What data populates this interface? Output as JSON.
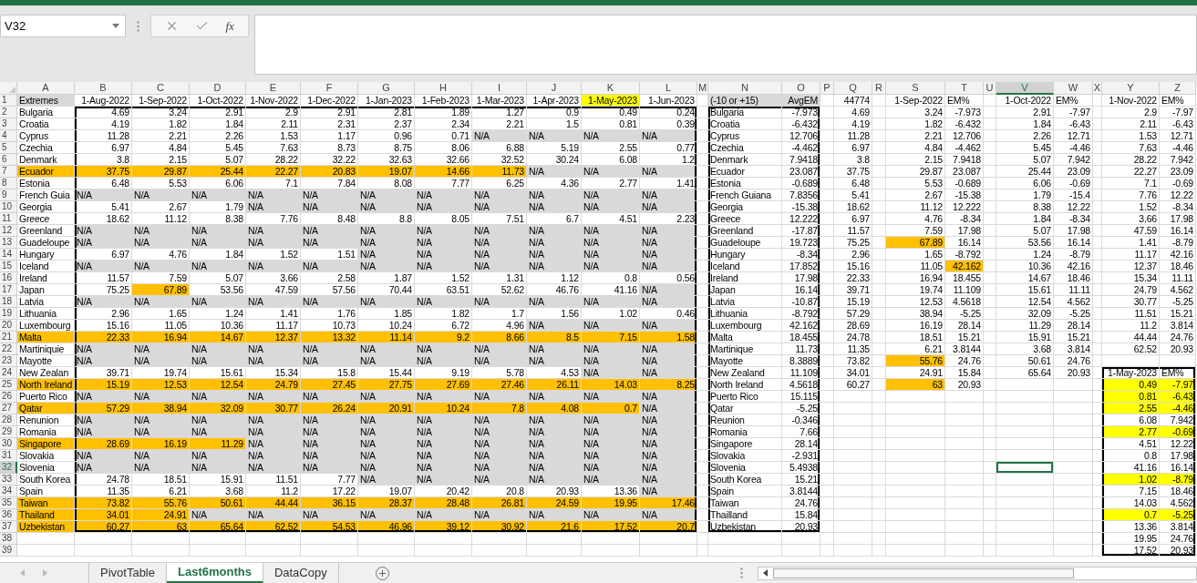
{
  "name_box": "V32",
  "function_label": "fx",
  "columns": [
    {
      "letter": "A",
      "selected": false
    },
    {
      "letter": "B",
      "selected": false
    },
    {
      "letter": "C",
      "selected": false
    },
    {
      "letter": "D",
      "selected": false
    },
    {
      "letter": "E",
      "selected": false
    },
    {
      "letter": "F",
      "selected": false
    },
    {
      "letter": "G",
      "selected": false
    },
    {
      "letter": "H",
      "selected": false
    },
    {
      "letter": "I",
      "selected": false
    },
    {
      "letter": "J",
      "selected": false
    },
    {
      "letter": "K",
      "selected": false
    },
    {
      "letter": "L",
      "selected": false
    },
    {
      "letter": "M",
      "selected": false
    },
    {
      "letter": "N",
      "selected": false
    },
    {
      "letter": "O",
      "selected": false
    },
    {
      "letter": "P",
      "selected": false
    },
    {
      "letter": "Q",
      "selected": false
    },
    {
      "letter": "R",
      "selected": false
    },
    {
      "letter": "S",
      "selected": false
    },
    {
      "letter": "T",
      "selected": false
    },
    {
      "letter": "U",
      "selected": false
    },
    {
      "letter": "V",
      "selected": true
    },
    {
      "letter": "W",
      "selected": false
    },
    {
      "letter": "X",
      "selected": false
    },
    {
      "letter": "Y",
      "selected": false
    },
    {
      "letter": "Z",
      "selected": false
    }
  ],
  "row_numbers": [
    {
      "number": "1",
      "selected": false
    },
    {
      "number": "2",
      "selected": false
    },
    {
      "number": "3",
      "selected": false
    },
    {
      "number": "4",
      "selected": false
    },
    {
      "number": "5",
      "selected": false
    },
    {
      "number": "6",
      "selected": false
    },
    {
      "number": "7",
      "selected": false
    },
    {
      "number": "8",
      "selected": false
    },
    {
      "number": "9",
      "selected": false
    },
    {
      "number": "10",
      "selected": false
    },
    {
      "number": "11",
      "selected": false
    },
    {
      "number": "12",
      "selected": false
    },
    {
      "number": "13",
      "selected": false
    },
    {
      "number": "14",
      "selected": false
    },
    {
      "number": "15",
      "selected": false
    },
    {
      "number": "16",
      "selected": false
    },
    {
      "number": "17",
      "selected": false
    },
    {
      "number": "18",
      "selected": false
    },
    {
      "number": "19",
      "selected": false
    },
    {
      "number": "20",
      "selected": false
    },
    {
      "number": "21",
      "selected": false
    },
    {
      "number": "22",
      "selected": false
    },
    {
      "number": "23",
      "selected": false
    },
    {
      "number": "24",
      "selected": false
    },
    {
      "number": "25",
      "selected": false
    },
    {
      "number": "26",
      "selected": false
    },
    {
      "number": "27",
      "selected": false
    },
    {
      "number": "28",
      "selected": false
    },
    {
      "number": "29",
      "selected": false
    },
    {
      "number": "30",
      "selected": false
    },
    {
      "number": "31",
      "selected": false
    },
    {
      "number": "32",
      "selected": true
    },
    {
      "number": "33",
      "selected": false
    },
    {
      "number": "34",
      "selected": false
    },
    {
      "number": "35",
      "selected": false
    },
    {
      "number": "36",
      "selected": false
    },
    {
      "number": "37",
      "selected": false
    },
    {
      "number": "38",
      "selected": false
    },
    {
      "number": "39",
      "selected": false
    }
  ],
  "main_table": {
    "corner": {
      "text": "Extremes",
      "color": "#d9d9d9"
    },
    "dates": [
      "1-Aug-2022",
      "1-Sep-2022",
      "1-Oct-2022",
      "1-Nov-2022",
      "1-Dec-2022",
      "1-Jan-2023",
      "1-Feb-2023",
      "1-Mar-2023",
      "1-Apr-2023",
      {
        "text": "1-May-2023",
        "color": "#ffff00"
      },
      "1-Jun-2023"
    ],
    "rows": [
      {
        "country": "Bulgaria",
        "values": [
          "4.69",
          "3.24",
          "2.91",
          "2.9",
          "2.91",
          "2.81",
          "1.89",
          "1.27",
          "0.9",
          "0.49",
          "0.24"
        ]
      },
      {
        "country": "Croatia",
        "values": [
          "4.19",
          "1.82",
          "1.84",
          "2.11",
          "2.31",
          "2.37",
          "2.34",
          "2.21",
          "1.5",
          "0.81",
          "0.39"
        ]
      },
      {
        "country": "Cyprus",
        "values": [
          "11.28",
          "2.21",
          "2.26",
          "1.53",
          "1.17",
          "0.96",
          "0.71",
          {
            "kind": "na",
            "text": "N/A"
          },
          {
            "kind": "na",
            "text": "N/A"
          },
          {
            "kind": "na",
            "text": "N/A"
          },
          {
            "kind": "na",
            "text": "N/A"
          }
        ]
      },
      {
        "country": "Czechia",
        "values": [
          "6.97",
          "4.84",
          "5.45",
          "7.63",
          "8.73",
          "8.75",
          "8.06",
          "6.88",
          "5.19",
          "2.55",
          "0.77"
        ]
      },
      {
        "country": "Denmark",
        "values": [
          "3.8",
          "2.15",
          "5.07",
          "28.22",
          "32.22",
          "32.63",
          "32.66",
          "32.52",
          "30.24",
          "6.08",
          "1.2"
        ]
      },
      {
        "country": "Ecuador",
        "color": "#ffc000",
        "values": [
          "37.75",
          "29.87",
          "25.44",
          "22.27",
          "20.83",
          "19.07",
          "14.66",
          "11.73",
          {
            "kind": "na",
            "text": "N/A"
          },
          {
            "kind": "na",
            "text": "N/A"
          },
          {
            "kind": "na",
            "text": "N/A"
          }
        ]
      },
      {
        "country": "Estonia",
        "values": [
          "6.48",
          "5.53",
          "6.06",
          "7.1",
          "7.84",
          "8.08",
          "7.77",
          "6.25",
          "4.36",
          "2.77",
          "1.41"
        ]
      },
      {
        "country": "French Guia",
        "values": [
          {
            "kind": "na",
            "text": "N/A"
          },
          {
            "kind": "na",
            "text": "N/A"
          },
          {
            "kind": "na",
            "text": "N/A"
          },
          {
            "kind": "na",
            "text": "N/A"
          },
          {
            "kind": "na",
            "text": "N/A"
          },
          {
            "kind": "na",
            "text": "N/A"
          },
          {
            "kind": "na",
            "text": "N/A"
          },
          {
            "kind": "na",
            "text": "N/A"
          },
          {
            "kind": "na",
            "text": "N/A"
          },
          {
            "kind": "na",
            "text": "N/A"
          },
          {
            "kind": "na",
            "text": "N/A"
          }
        ]
      },
      {
        "country": "Georgia",
        "values": [
          "5.41",
          "2.67",
          "1.79",
          {
            "kind": "na",
            "text": "N/A"
          },
          {
            "kind": "na",
            "text": "N/A"
          },
          {
            "kind": "na",
            "text": "N/A"
          },
          {
            "kind": "na",
            "text": "N/A"
          },
          {
            "kind": "na",
            "text": "N/A"
          },
          {
            "kind": "na",
            "text": "N/A"
          },
          {
            "kind": "na",
            "text": "N/A"
          },
          {
            "kind": "na",
            "text": "N/A"
          }
        ]
      },
      {
        "country": "Greece",
        "values": [
          "18.62",
          "11.12",
          "8.38",
          "7.76",
          "8.48",
          "8.8",
          "8.05",
          "7.51",
          "6.7",
          "4.51",
          "2.23"
        ]
      },
      {
        "country": "Greenland",
        "values": [
          {
            "kind": "na",
            "text": "N/A"
          },
          {
            "kind": "na",
            "text": "N/A"
          },
          {
            "kind": "na",
            "text": "N/A"
          },
          {
            "kind": "na",
            "text": "N/A"
          },
          {
            "kind": "na",
            "text": "N/A"
          },
          {
            "kind": "na",
            "text": "N/A"
          },
          {
            "kind": "na",
            "text": "N/A"
          },
          {
            "kind": "na",
            "text": "N/A"
          },
          {
            "kind": "na",
            "text": "N/A"
          },
          {
            "kind": "na",
            "text": "N/A"
          },
          {
            "kind": "na",
            "text": "N/A"
          }
        ]
      },
      {
        "country": "Guadeloupe",
        "values": [
          {
            "kind": "na",
            "text": "N/A"
          },
          {
            "kind": "na",
            "text": "N/A"
          },
          {
            "kind": "na",
            "text": "N/A"
          },
          {
            "kind": "na",
            "text": "N/A"
          },
          {
            "kind": "na",
            "text": "N/A"
          },
          {
            "kind": "na",
            "text": "N/A"
          },
          {
            "kind": "na",
            "text": "N/A"
          },
          {
            "kind": "na",
            "text": "N/A"
          },
          {
            "kind": "na",
            "text": "N/A"
          },
          {
            "kind": "na",
            "text": "N/A"
          },
          {
            "kind": "na",
            "text": "N/A"
          }
        ]
      },
      {
        "country": "Hungary",
        "values": [
          "6.97",
          "4.76",
          "1.84",
          "1.52",
          "1.51",
          {
            "kind": "na",
            "text": "N/A"
          },
          {
            "kind": "na",
            "text": "N/A"
          },
          {
            "kind": "na",
            "text": "N/A"
          },
          {
            "kind": "na",
            "text": "N/A"
          },
          {
            "kind": "na",
            "text": "N/A"
          },
          {
            "kind": "na",
            "text": "N/A"
          }
        ]
      },
      {
        "country": "Iceland",
        "values": [
          {
            "kind": "na",
            "text": "N/A"
          },
          {
            "kind": "na",
            "text": "N/A"
          },
          {
            "kind": "na",
            "text": "N/A"
          },
          {
            "kind": "na",
            "text": "N/A"
          },
          {
            "kind": "na",
            "text": "N/A"
          },
          {
            "kind": "na",
            "text": "N/A"
          },
          {
            "kind": "na",
            "text": "N/A"
          },
          {
            "kind": "na",
            "text": "N/A"
          },
          {
            "kind": "na",
            "text": "N/A"
          },
          {
            "kind": "na",
            "text": "N/A"
          },
          {
            "kind": "na",
            "text": "N/A"
          }
        ]
      },
      {
        "country": "Ireland",
        "values": [
          "11.57",
          "7.59",
          "5.07",
          "3.66",
          "2.58",
          "1.87",
          "1.52",
          "1.31",
          "1.12",
          "0.8",
          "0.56"
        ]
      },
      {
        "country": "Japan",
        "values": [
          "75.25",
          {
            "text": "67.89",
            "color": "#ffc000"
          },
          "53.56",
          "47.59",
          "57.56",
          "70.44",
          "63.51",
          "52.62",
          "46.76",
          "41.16",
          {
            "kind": "na",
            "text": "N/A"
          }
        ]
      },
      {
        "country": "Latvia",
        "values": [
          {
            "kind": "na",
            "text": "N/A"
          },
          {
            "kind": "na",
            "text": "N/A"
          },
          {
            "kind": "na",
            "text": "N/A"
          },
          {
            "kind": "na",
            "text": "N/A"
          },
          {
            "kind": "na",
            "text": "N/A"
          },
          {
            "kind": "na",
            "text": "N/A"
          },
          {
            "kind": "na",
            "text": "N/A"
          },
          {
            "kind": "na",
            "text": "N/A"
          },
          {
            "kind": "na",
            "text": "N/A"
          },
          {
            "kind": "na",
            "text": "N/A"
          },
          {
            "kind": "na",
            "text": "N/A"
          }
        ]
      },
      {
        "country": "Lithuania",
        "values": [
          "2.96",
          "1.65",
          "1.24",
          "1.41",
          "1.76",
          "1.85",
          "1.82",
          "1.7",
          "1.56",
          "1.02",
          "0.46"
        ]
      },
      {
        "country": "Luxembourg",
        "values": [
          "15.16",
          "11.05",
          "10.36",
          "11.17",
          "10.73",
          "10.24",
          "6.72",
          "4.96",
          {
            "kind": "na",
            "text": "N/A"
          },
          {
            "kind": "na",
            "text": "N/A"
          },
          {
            "kind": "na",
            "text": "N/A"
          }
        ]
      },
      {
        "country": "Malta",
        "color": "#ffc000",
        "values": [
          "22.33",
          "16.94",
          "14.67",
          "12.37",
          "13.32",
          "11.14",
          "9.2",
          "8.66",
          "8.5",
          "7.15",
          "1.58"
        ]
      },
      {
        "country": "Martiniquie",
        "values": [
          {
            "kind": "na",
            "text": "N/A"
          },
          {
            "kind": "na",
            "text": "N/A"
          },
          {
            "kind": "na",
            "text": "N/A"
          },
          {
            "kind": "na",
            "text": "N/A"
          },
          {
            "kind": "na",
            "text": "N/A"
          },
          {
            "kind": "na",
            "text": "N/A"
          },
          {
            "kind": "na",
            "text": "N/A"
          },
          {
            "kind": "na",
            "text": "N/A"
          },
          {
            "kind": "na",
            "text": "N/A"
          },
          {
            "kind": "na",
            "text": "N/A"
          },
          {
            "kind": "na",
            "text": "N/A"
          }
        ]
      },
      {
        "country": "Mayotte",
        "values": [
          {
            "kind": "na",
            "text": "N/A"
          },
          {
            "kind": "na",
            "text": "N/A"
          },
          {
            "kind": "na",
            "text": "N/A"
          },
          {
            "kind": "na",
            "text": "N/A"
          },
          {
            "kind": "na",
            "text": "N/A"
          },
          {
            "kind": "na",
            "text": "N/A"
          },
          {
            "kind": "na",
            "text": "N/A"
          },
          {
            "kind": "na",
            "text": "N/A"
          },
          {
            "kind": "na",
            "text": "N/A"
          },
          {
            "kind": "na",
            "text": "N/A"
          },
          {
            "kind": "na",
            "text": "N/A"
          }
        ]
      },
      {
        "country": "New Zealan",
        "values": [
          "39.71",
          "19.74",
          "15.61",
          "15.34",
          "15.8",
          "15.44",
          "9.19",
          "5.78",
          "4.53",
          {
            "kind": "na",
            "text": "N/A"
          },
          {
            "kind": "na",
            "text": "N/A"
          }
        ]
      },
      {
        "country": "North Ireland",
        "color": "#ffc000",
        "values": [
          "15.19",
          "12.53",
          "12.54",
          "24.79",
          "27.45",
          "27.75",
          "27.69",
          "27.46",
          "26.11",
          "14.03",
          "8.25"
        ]
      },
      {
        "country": "Puerto Rico",
        "values": [
          {
            "kind": "na",
            "text": "N/A"
          },
          {
            "kind": "na",
            "text": "N/A"
          },
          {
            "kind": "na",
            "text": "N/A"
          },
          {
            "kind": "na",
            "text": "N/A"
          },
          {
            "kind": "na",
            "text": "N/A"
          },
          {
            "kind": "na",
            "text": "N/A"
          },
          {
            "kind": "na",
            "text": "N/A"
          },
          {
            "kind": "na",
            "text": "N/A"
          },
          {
            "kind": "na",
            "text": "N/A"
          },
          {
            "kind": "na",
            "text": "N/A"
          },
          {
            "kind": "na",
            "text": "N/A"
          }
        ]
      },
      {
        "country": "Qatar",
        "color": "#ffc000",
        "values": [
          "57.29",
          "38.94",
          "32.09",
          "30.77",
          "26.24",
          "20.91",
          "10.24",
          "7.8",
          "4.08",
          "0.7",
          {
            "kind": "na",
            "text": "N/A"
          }
        ]
      },
      {
        "country": "Renunion",
        "values": [
          {
            "kind": "na",
            "text": "N/A"
          },
          {
            "kind": "na",
            "text": "N/A"
          },
          {
            "kind": "na",
            "text": "N/A"
          },
          {
            "kind": "na",
            "text": "N/A"
          },
          {
            "kind": "na",
            "text": "N/A"
          },
          {
            "kind": "na",
            "text": "N/A"
          },
          {
            "kind": "na",
            "text": "N/A"
          },
          {
            "kind": "na",
            "text": "N/A"
          },
          {
            "kind": "na",
            "text": "N/A"
          },
          {
            "kind": "na",
            "text": "N/A"
          },
          {
            "kind": "na",
            "text": "N/A"
          }
        ]
      },
      {
        "country": "Romania",
        "values": [
          {
            "kind": "na",
            "text": "N/A"
          },
          {
            "kind": "na",
            "text": "N/A"
          },
          {
            "kind": "na",
            "text": "N/A"
          },
          {
            "kind": "na",
            "text": "N/A"
          },
          {
            "kind": "na",
            "text": "N/A"
          },
          {
            "kind": "na",
            "text": "N/A"
          },
          {
            "kind": "na",
            "text": "N/A"
          },
          {
            "kind": "na",
            "text": "N/A"
          },
          {
            "kind": "na",
            "text": "N/A"
          },
          {
            "kind": "na",
            "text": "N/A"
          },
          {
            "kind": "na",
            "text": "N/A"
          }
        ]
      },
      {
        "country": "Singapore",
        "color": "#ffc000",
        "values": [
          "28.69",
          "16.19",
          "11.29",
          {
            "kind": "na",
            "text": "N/A"
          },
          {
            "kind": "na",
            "text": "N/A"
          },
          {
            "kind": "na",
            "text": "N/A"
          },
          {
            "kind": "na",
            "text": "N/A"
          },
          {
            "kind": "na",
            "text": "N/A"
          },
          {
            "kind": "na",
            "text": "N/A"
          },
          {
            "kind": "na",
            "text": "N/A"
          },
          {
            "kind": "na",
            "text": "N/A"
          }
        ]
      },
      {
        "country": "Slovakia",
        "values": [
          {
            "kind": "na",
            "text": "N/A"
          },
          {
            "kind": "na",
            "text": "N/A"
          },
          {
            "kind": "na",
            "text": "N/A"
          },
          {
            "kind": "na",
            "text": "N/A"
          },
          {
            "kind": "na",
            "text": "N/A"
          },
          {
            "kind": "na",
            "text": "N/A"
          },
          {
            "kind": "na",
            "text": "N/A"
          },
          {
            "kind": "na",
            "text": "N/A"
          },
          {
            "kind": "na",
            "text": "N/A"
          },
          {
            "kind": "na",
            "text": "N/A"
          },
          {
            "kind": "na",
            "text": "N/A"
          }
        ]
      },
      {
        "country": "Slovenia",
        "values": [
          {
            "kind": "na",
            "text": "N/A"
          },
          {
            "kind": "na",
            "text": "N/A"
          },
          {
            "kind": "na",
            "text": "N/A"
          },
          {
            "kind": "na",
            "text": "N/A"
          },
          {
            "kind": "na",
            "text": "N/A"
          },
          {
            "kind": "na",
            "text": "N/A"
          },
          {
            "kind": "na",
            "text": "N/A"
          },
          {
            "kind": "na",
            "text": "N/A"
          },
          {
            "kind": "na",
            "text": "N/A"
          },
          {
            "kind": "na",
            "text": "N/A"
          },
          {
            "kind": "na",
            "text": "N/A"
          }
        ]
      },
      {
        "country": "South Korea",
        "values": [
          "24.78",
          "18.51",
          "15.91",
          "11.51",
          "7.77",
          {
            "kind": "na",
            "text": "N/A"
          },
          {
            "kind": "na",
            "text": "N/A"
          },
          {
            "kind": "na",
            "text": "N/A"
          },
          {
            "kind": "na",
            "text": "N/A"
          },
          {
            "kind": "na",
            "text": "N/A"
          },
          {
            "kind": "na",
            "text": "N/A"
          }
        ]
      },
      {
        "country": "Spain",
        "values": [
          "11.35",
          "6.21",
          "3.68",
          "11.2",
          "17.22",
          "19.07",
          "20.42",
          "20.8",
          "20.93",
          "13.36",
          {
            "kind": "na",
            "text": "N/A"
          }
        ]
      },
      {
        "country": "Taiwan",
        "color": "#ffc000",
        "values": [
          "73.82",
          "55.76",
          "50.61",
          "44.44",
          "36.15",
          "28.37",
          "28.48",
          "26.81",
          "24.59",
          "19.95",
          "17.46"
        ]
      },
      {
        "country": "Thailand",
        "color": "#ffc000",
        "values": [
          "34.01",
          "24.91",
          {
            "kind": "na",
            "text": "N/A"
          },
          {
            "kind": "na",
            "text": "N/A"
          },
          {
            "kind": "na",
            "text": "N/A"
          },
          {
            "kind": "na",
            "text": "N/A"
          },
          {
            "kind": "na",
            "text": "N/A"
          },
          {
            "kind": "na",
            "text": "N/A"
          },
          {
            "kind": "na",
            "text": "N/A"
          },
          {
            "kind": "na",
            "text": "N/A"
          },
          {
            "kind": "na",
            "text": "N/A"
          }
        ]
      },
      {
        "country": "Uzbekistan",
        "color": "#ffc000",
        "values": [
          "60.27",
          "63",
          "65.64",
          "62.52",
          "54.53",
          "46.96",
          "39.12",
          "30.92",
          "21.6",
          "17.52",
          "20.7"
        ]
      }
    ]
  },
  "avg_table": {
    "headers": [
      {
        "text": "(-10 or +15)",
        "color": "#d9d9d9"
      },
      {
        "text": "AvgEM",
        "color": "#d9d9d9"
      }
    ],
    "rows": [
      {
        "country": "Bulgaria",
        "avg_em": "-7.973"
      },
      {
        "country": "Croatia",
        "avg_em": "-6.432"
      },
      {
        "country": "Cyprus",
        "avg_em": "12.706"
      },
      {
        "country": "Czechia",
        "avg_em": "-4.462"
      },
      {
        "country": "Denmark",
        "avg_em": "7.9418"
      },
      {
        "country": "Ecuador",
        "avg_em": "23.087"
      },
      {
        "country": "Estonia",
        "avg_em": "-0.689"
      },
      {
        "country": "French Guiana",
        "avg_em": "7.8356"
      },
      {
        "country": "Georgia",
        "avg_em": "-15.38"
      },
      {
        "country": "Greece",
        "avg_em": "12.222"
      },
      {
        "country": "Greenland",
        "avg_em": "-17.87"
      },
      {
        "country": "Guadeloupe",
        "avg_em": "19.723"
      },
      {
        "country": "Hungary",
        "avg_em": "-8.34"
      },
      {
        "country": "Iceland",
        "avg_em": "17.852"
      },
      {
        "country": "Ireland",
        "avg_em": "17.98"
      },
      {
        "country": "Japan",
        "avg_em": "16.14"
      },
      {
        "country": "Latvia",
        "avg_em": "-10.87"
      },
      {
        "country": "Lithuania",
        "avg_em": "-8.792"
      },
      {
        "country": "Luxembourg",
        "avg_em": "42.162"
      },
      {
        "country": "Malta",
        "avg_em": "18.455"
      },
      {
        "country": "Martinique",
        "avg_em": "11.73"
      },
      {
        "country": "Mayotte",
        "avg_em": "8.3889"
      },
      {
        "country": "New Zealand",
        "avg_em": "11.109"
      },
      {
        "country": "North Ireland",
        "avg_em": "4.5618"
      },
      {
        "country": "Puerto Rico",
        "avg_em": "15.115"
      },
      {
        "country": "Qatar",
        "avg_em": "-5.25"
      },
      {
        "country": "Reunion",
        "avg_em": "-0.346"
      },
      {
        "country": "Romania",
        "avg_em": "7.66"
      },
      {
        "country": "Singapore",
        "avg_em": "28.14"
      },
      {
        "country": "Slovakia",
        "avg_em": "-2.931"
      },
      {
        "country": "Slovenia",
        "avg_em": "5.4938"
      },
      {
        "country": "South Korea",
        "avg_em": "15.21"
      },
      {
        "country": "Spain",
        "avg_em": "3.8144"
      },
      {
        "country": "Taiwan",
        "avg_em": "24.76"
      },
      {
        "country": "Thailland",
        "avg_em": "15.84"
      },
      {
        "country": "Uzbekistan",
        "avg_em": "20.93"
      }
    ]
  },
  "q_column": {
    "header": "44774",
    "values": [
      "4.69",
      "4.19",
      "11.28",
      "6.97",
      "3.8",
      "37.75",
      "6.48",
      "5.41",
      "18.62",
      "6.97",
      "11.57",
      "75.25",
      "2.96",
      "15.16",
      "22.33",
      "39.71",
      "15.19",
      "57.29",
      "28.69",
      "24.78",
      "11.35",
      "73.82",
      "34.01",
      "60.27"
    ]
  },
  "pairs": [
    {
      "date": "1-Sep-2022",
      "em_header": "EM%",
      "rows": [
        {
          "value": "3.24",
          "em": "-7.973"
        },
        {
          "value": "1.82",
          "em": "-6.432"
        },
        {
          "value": "2.21",
          "em": "12.706"
        },
        {
          "value": "4.84",
          "em": "-4.462"
        },
        {
          "value": "2.15",
          "em": "7.9418"
        },
        {
          "value": "29.87",
          "em": "23.087"
        },
        {
          "value": "5.53",
          "em": "-0.689"
        },
        {
          "value": "2.67",
          "em": "-15.38"
        },
        {
          "value": "11.12",
          "em": "12.222"
        },
        {
          "value": "4.76",
          "em": "-8.34"
        },
        {
          "value": "7.59",
          "em": "17.98"
        },
        {
          "value": {
            "text": "67.89",
            "color": "#ffc000"
          },
          "em": "16.14"
        },
        {
          "value": "1.65",
          "em": "-8.792"
        },
        {
          "value": "11.05",
          "em": {
            "text": "42.162",
            "color": "#ffc000"
          }
        },
        {
          "value": "16.94",
          "em": "18.455"
        },
        {
          "value": "19.74",
          "em": "11.109"
        },
        {
          "value": "12.53",
          "em": "4.5618"
        },
        {
          "value": "38.94",
          "em": "-5.25"
        },
        {
          "value": "16.19",
          "em": "28.14"
        },
        {
          "value": "18.51",
          "em": "15.21"
        },
        {
          "value": "6.21",
          "em": "3.8144"
        },
        {
          "value": {
            "text": "55.76",
            "color": "#ffc000"
          },
          "em": "24.76"
        },
        {
          "value": "24.91",
          "em": "15.84"
        },
        {
          "value": {
            "text": "63",
            "color": "#ffc000"
          },
          "em": "20.93"
        }
      ]
    },
    {
      "date": "1-Oct-2022",
      "em_header": "EM%",
      "rows": [
        {
          "value": "2.91",
          "em": "-7.97"
        },
        {
          "value": "1.84",
          "em": "-6.43"
        },
        {
          "value": "2.26",
          "em": "12.71"
        },
        {
          "value": "5.45",
          "em": "-4.46"
        },
        {
          "value": "5.07",
          "em": "7.942"
        },
        {
          "value": "25.44",
          "em": "23.09"
        },
        {
          "value": "6.06",
          "em": "-0.69"
        },
        {
          "value": "1.79",
          "em": "-15.4"
        },
        {
          "value": "8.38",
          "em": "12.22"
        },
        {
          "value": "1.84",
          "em": "-8.34"
        },
        {
          "value": "5.07",
          "em": "17.98"
        },
        {
          "value": "53.56",
          "em": "16.14"
        },
        {
          "value": "1.24",
          "em": "-8.79"
        },
        {
          "value": "10.36",
          "em": "42.16"
        },
        {
          "value": "14.67",
          "em": "18.46"
        },
        {
          "value": "15.61",
          "em": "11.11"
        },
        {
          "value": "12.54",
          "em": "4.562"
        },
        {
          "value": "32.09",
          "em": "-5.25"
        },
        {
          "value": "11.29",
          "em": "28.14"
        },
        {
          "value": "15.91",
          "em": "15.21"
        },
        {
          "value": "3.68",
          "em": "3.814"
        },
        {
          "value": "50.61",
          "em": "24.76"
        },
        {
          "value": "65.64",
          "em": "20.93"
        }
      ]
    },
    {
      "date": "1-Nov-2022",
      "em_header": "EM%",
      "rows": [
        {
          "value": "2.9",
          "em": "-7.97"
        },
        {
          "value": "2.11",
          "em": "-6.43"
        },
        {
          "value": "1.53",
          "em": "12.71"
        },
        {
          "value": "7.63",
          "em": "-4.46"
        },
        {
          "value": "28.22",
          "em": "7.942"
        },
        {
          "value": "22.27",
          "em": "23.09"
        },
        {
          "value": "7.1",
          "em": "-0.69"
        },
        {
          "value": "7.76",
          "em": "12.22"
        },
        {
          "value": "1.52",
          "em": "-8.34"
        },
        {
          "value": "3.66",
          "em": "17.98"
        },
        {
          "value": "47.59",
          "em": "16.14"
        },
        {
          "value": "1.41",
          "em": "-8.79"
        },
        {
          "value": "11.17",
          "em": "42.16"
        },
        {
          "value": "12.37",
          "em": "18.46"
        },
        {
          "value": "15.34",
          "em": "11.11"
        },
        {
          "value": "24.79",
          "em": "4.562"
        },
        {
          "value": "30.77",
          "em": "-5.25"
        },
        {
          "value": "11.51",
          "em": "15.21"
        },
        {
          "value": "11.2",
          "em": "3.814"
        },
        {
          "value": "44.44",
          "em": "24.76"
        },
        {
          "value": "62.52",
          "em": "20.93"
        }
      ]
    }
  ],
  "may_table": {
    "date": "1-May-2023",
    "em_header": "EM%",
    "rows": [
      {
        "value": "0.49",
        "em": "-7.97",
        "color": "#ffff00"
      },
      {
        "value": "0.81",
        "em": "-6.43",
        "color": "#ffff00"
      },
      {
        "value": "2.55",
        "em": "-4.46",
        "color": "#ffff00"
      },
      {
        "value": "6.08",
        "em": "7.942"
      },
      {
        "value": "2.77",
        "em": "-0.69",
        "color": "#ffff00"
      },
      {
        "value": "4.51",
        "em": "12.22"
      },
      {
        "value": "0.8",
        "em": "17.98"
      },
      {
        "value": "41.16",
        "em": "16.14"
      },
      {
        "value": "1.02",
        "em": "-8.79",
        "color": "#ffff00"
      },
      {
        "value": "7.15",
        "em": "18.46"
      },
      {
        "value": "14.03",
        "em": "4.562"
      },
      {
        "value": "0.7",
        "em": "-5.25",
        "color": "#ffff00"
      },
      {
        "value": "13.36",
        "em": "3.814"
      },
      {
        "value": "19.95",
        "em": "24.76"
      },
      {
        "value": "17.52",
        "em": "20.93"
      }
    ]
  },
  "sheet_tabs": [
    {
      "label": "PivotTable",
      "selected": false
    },
    {
      "label": "Last6months",
      "selected": true
    },
    {
      "label": "DataCopy",
      "selected": false
    }
  ]
}
